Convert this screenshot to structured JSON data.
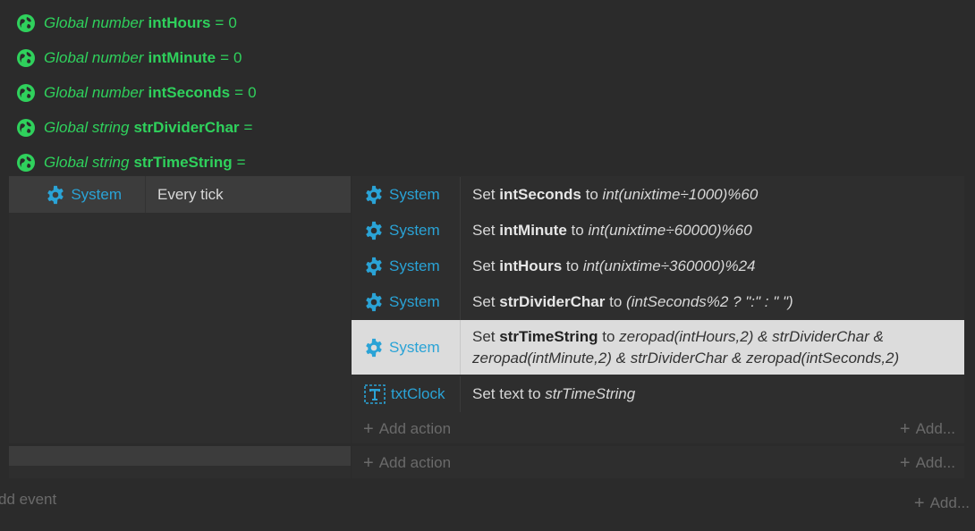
{
  "globals": [
    {
      "kw": "Global number",
      "name": "intHours",
      "eq": "=",
      "value": "0"
    },
    {
      "kw": "Global number",
      "name": "intMinute",
      "eq": "=",
      "value": "0"
    },
    {
      "kw": "Global number",
      "name": "intSeconds",
      "eq": "=",
      "value": "0"
    },
    {
      "kw": "Global string",
      "name": "strDividerChar",
      "eq": "=",
      "value": ""
    },
    {
      "kw": "Global string",
      "name": "strTimeString",
      "eq": "=",
      "value": ""
    }
  ],
  "event": {
    "condition": {
      "object": "System",
      "text": "Every tick"
    },
    "actions": [
      {
        "object": "System",
        "set": "Set",
        "var": "intSeconds",
        "to": "to",
        "expr": "int(unixtime÷1000)%60"
      },
      {
        "object": "System",
        "set": "Set",
        "var": "intMinute",
        "to": "to",
        "expr": "int(unixtime÷60000)%60"
      },
      {
        "object": "System",
        "set": "Set",
        "var": "intHours",
        "to": "to",
        "expr": "int(unixtime÷360000)%24"
      },
      {
        "object": "System",
        "set": "Set",
        "var": "strDividerChar",
        "to": "to",
        "expr": "(intSeconds%2 ? \":\" : \" \")"
      },
      {
        "object": "System",
        "set": "Set",
        "var": "strTimeString",
        "to": "to",
        "expr_line1": "zeropad(intHours,2) & strDividerChar &",
        "expr_line2": "zeropad(intMinute,2) & strDividerChar & zeropad(intSeconds,2)"
      },
      {
        "object": "txtClock",
        "set": "Set text to",
        "expr": "strTimeString"
      }
    ],
    "add_action": "Add action",
    "add_more": "Add..."
  },
  "sub_event": {
    "add_action": "Add action",
    "add_more": "Add..."
  },
  "footer": {
    "add_event": "dd event",
    "add_more": "Add..."
  },
  "colors": {
    "global": "#2fd15c",
    "object": "#2aa3d6",
    "selected": "#dcdcdc"
  },
  "icons": {
    "global": "globe-icon",
    "system": "gear-icon",
    "text": "text-object-icon",
    "add": "plus-icon"
  }
}
